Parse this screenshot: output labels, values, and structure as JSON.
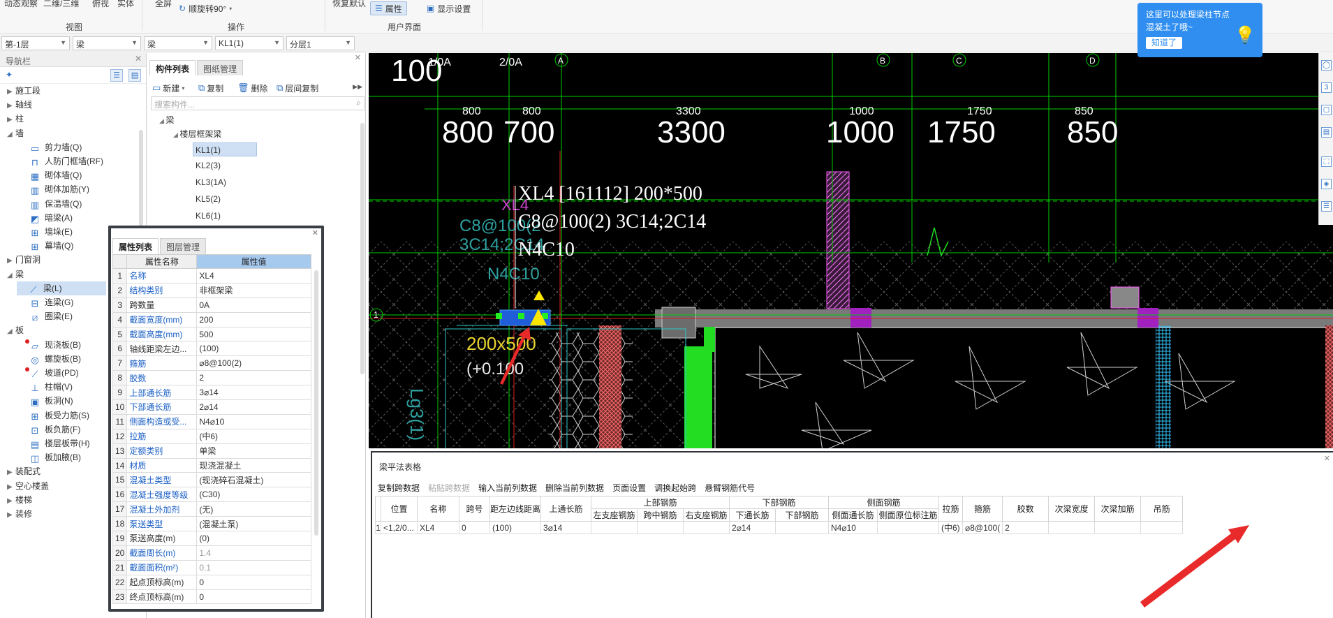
{
  "ribbon": {
    "top_items": [
      "动态观察",
      "二维/三维",
      "俯视",
      "实体",
      "全屏",
      "恢复默认"
    ],
    "groups": [
      "视图",
      "操作",
      "用户界面"
    ],
    "rotate_label": "顺旋转90°",
    "property_label": "属性",
    "display_settings_label": "显示设置"
  },
  "filters": [
    "第-1层",
    "梁",
    "梁",
    "KL1(1)",
    "分层1"
  ],
  "nav": {
    "title": "导航栏",
    "items": [
      {
        "label": "施工段",
        "type": "cat"
      },
      {
        "label": "轴线",
        "type": "cat"
      },
      {
        "label": "柱",
        "type": "cat"
      },
      {
        "label": "墙",
        "type": "cat_open"
      },
      {
        "label": "剪力墙(Q)",
        "type": "sub",
        "icon": "shear-wall-icon"
      },
      {
        "label": "人防门框墙(RF)",
        "type": "sub",
        "icon": "civil-defense-door-wall-icon"
      },
      {
        "label": "砌体墙(Q)",
        "type": "sub",
        "icon": "masonry-wall-icon"
      },
      {
        "label": "砌体加筋(Y)",
        "type": "sub",
        "icon": "masonry-reinforcement-icon"
      },
      {
        "label": "保温墙(Q)",
        "type": "sub",
        "icon": "insulation-wall-icon"
      },
      {
        "label": "暗梁(A)",
        "type": "sub",
        "icon": "hidden-beam-icon"
      },
      {
        "label": "墙垛(E)",
        "type": "sub",
        "icon": "wall-pier-icon"
      },
      {
        "label": "幕墙(Q)",
        "type": "sub",
        "icon": "curtain-wall-icon"
      },
      {
        "label": "门窗洞",
        "type": "cat"
      },
      {
        "label": "梁",
        "type": "cat_open"
      },
      {
        "label": "梁(L)",
        "type": "sub_sel",
        "icon": "beam-icon"
      },
      {
        "label": "连梁(G)",
        "type": "sub",
        "icon": "coupling-beam-icon"
      },
      {
        "label": "圈梁(E)",
        "type": "sub",
        "icon": "ring-beam-icon"
      },
      {
        "label": "板",
        "type": "cat_open"
      },
      {
        "label": "现浇板(B)",
        "type": "sub_dot",
        "icon": "cast-slab-icon"
      },
      {
        "label": "螺旋板(B)",
        "type": "sub",
        "icon": "spiral-slab-icon"
      },
      {
        "label": "坡道(PD)",
        "type": "sub_dot",
        "icon": "ramp-icon"
      },
      {
        "label": "柱帽(V)",
        "type": "sub",
        "icon": "column-cap-icon"
      },
      {
        "label": "板洞(N)",
        "type": "sub",
        "icon": "slab-hole-icon"
      },
      {
        "label": "板受力筋(S)",
        "type": "sub",
        "icon": "slab-rebar-icon"
      },
      {
        "label": "板负筋(F)",
        "type": "sub",
        "icon": "negative-rebar-icon"
      },
      {
        "label": "楼层板带(H)",
        "type": "sub",
        "icon": "floor-strip-icon"
      },
      {
        "label": "板加腋(B)",
        "type": "sub",
        "icon": "slab-haunch-icon"
      },
      {
        "label": "装配式",
        "type": "cat"
      },
      {
        "label": "空心楼盖",
        "type": "cat"
      },
      {
        "label": "楼梯",
        "type": "cat"
      },
      {
        "label": "装修",
        "type": "cat"
      }
    ]
  },
  "components": {
    "tabs": [
      "构件列表",
      "图纸管理"
    ],
    "toolbar": {
      "new": "新建",
      "copy": "复制",
      "delete": "删除",
      "floor_copy": "层间复制"
    },
    "search_placeholder": "搜索构件...",
    "tree_root": "梁",
    "tree_group": "楼层框架梁",
    "items": [
      "KL1(1)",
      "KL2(3)",
      "KL3(1A)",
      "KL5(2)",
      "KL6(1)"
    ]
  },
  "properties": {
    "tabs": [
      "属性列表",
      "图层管理"
    ],
    "header_name": "属性名称",
    "header_value": "属性值",
    "rows": [
      {
        "n": "1",
        "name": "名称",
        "value": "XL4",
        "blue": true,
        "grey": false
      },
      {
        "n": "2",
        "name": "结构类别",
        "value": "非框架梁",
        "blue": true,
        "grey": false
      },
      {
        "n": "3",
        "name": "跨数量",
        "value": "0A",
        "blue": false,
        "grey": false
      },
      {
        "n": "4",
        "name": "截面宽度(mm)",
        "value": "200",
        "blue": true,
        "grey": false
      },
      {
        "n": "5",
        "name": "截面高度(mm)",
        "value": "500",
        "blue": true,
        "grey": false
      },
      {
        "n": "6",
        "name": "轴线距梁左边...",
        "value": "(100)",
        "blue": false,
        "grey": false
      },
      {
        "n": "7",
        "name": "箍筋",
        "value": "⌀8@100(2)",
        "blue": true,
        "grey": false
      },
      {
        "n": "8",
        "name": "胶数",
        "value": "2",
        "blue": true,
        "grey": false
      },
      {
        "n": "9",
        "name": "上部通长筋",
        "value": "3⌀14",
        "blue": true,
        "grey": false
      },
      {
        "n": "10",
        "name": "下部通长筋",
        "value": "2⌀14",
        "blue": true,
        "grey": false
      },
      {
        "n": "11",
        "name": "侧面构造或受...",
        "value": "N4⌀10",
        "blue": true,
        "grey": false
      },
      {
        "n": "12",
        "name": "拉筋",
        "value": "(中6)",
        "blue": true,
        "grey": false
      },
      {
        "n": "13",
        "name": "定额类别",
        "value": "单梁",
        "blue": true,
        "grey": false
      },
      {
        "n": "14",
        "name": "材质",
        "value": "现浇混凝土",
        "blue": true,
        "grey": false
      },
      {
        "n": "15",
        "name": "混凝土类型",
        "value": "(现浇碎石混凝土)",
        "blue": true,
        "grey": false
      },
      {
        "n": "16",
        "name": "混凝土强度等级",
        "value": "(C30)",
        "blue": true,
        "grey": false
      },
      {
        "n": "17",
        "name": "混凝土外加剂",
        "value": "(无)",
        "blue": true,
        "grey": false
      },
      {
        "n": "18",
        "name": "泵送类型",
        "value": "(混凝土泵)",
        "blue": true,
        "grey": false
      },
      {
        "n": "19",
        "name": "泵送高度(m)",
        "value": "(0)",
        "blue": false,
        "grey": false
      },
      {
        "n": "20",
        "name": "截面周长(m)",
        "value": "1.4",
        "blue": true,
        "grey": true
      },
      {
        "n": "21",
        "name": "截面面积(m²)",
        "value": "0.1",
        "blue": true,
        "grey": true
      },
      {
        "n": "22",
        "name": "起点顶标高(m)",
        "value": "0",
        "blue": false,
        "grey": false
      },
      {
        "n": "23",
        "name": "终点顶标高(m)",
        "value": "0",
        "blue": false,
        "grey": false
      }
    ]
  },
  "cad": {
    "axis_labels": [
      "1/0A",
      "2/0A",
      "A",
      "B",
      "C",
      "D",
      "1"
    ],
    "dims_small": [
      "800",
      "800",
      "3300",
      "1000",
      "1750",
      "850"
    ],
    "dims_large": [
      "800",
      "700",
      "3300",
      "1000",
      "1750",
      "850"
    ],
    "dim_left": "100",
    "beam_annotation": [
      "XL4 [161112] 200*500",
      "C8@100(2) 3C14;2C14",
      "N4C10"
    ],
    "section_label": "200x500",
    "elevation_label": "(+0.100",
    "faded_labels": [
      "XL4",
      "C8@100(2",
      "3C14;2C14",
      "N4C10"
    ],
    "side_label": "Lg3(1)"
  },
  "tooltip": {
    "line1": "这里可以处理梁柱节点",
    "line2": "混凝土了哦~",
    "ok": "知道了"
  },
  "beam_table": {
    "title": "梁平法表格",
    "toolbar": [
      "复制跨数据",
      "粘贴跨数据",
      "输入当前列数据",
      "删除当前列数据",
      "页面设置",
      "调换起始跨",
      "悬臂钢筋代号"
    ],
    "group_headers": {
      "top": "上部钢筋",
      "bottom": "下部钢筋",
      "side": "侧面钢筋"
    },
    "columns": [
      "位置",
      "名称",
      "跨号",
      "距左边线距离",
      "上通长筋",
      "左支座钢筋",
      "跨中钢筋",
      "右支座钢筋",
      "下通长筋",
      "下部钢筋",
      "侧面通长筋",
      "侧面原位标注筋",
      "拉筋",
      "箍筋",
      "胶数",
      "次梁宽度",
      "次梁加筋",
      "吊筋"
    ],
    "row": [
      "1",
      "<1,2/0...",
      "XL4",
      "0",
      "(100)",
      "3⌀14",
      "",
      "",
      "",
      "2⌀14",
      "",
      "N4⌀10",
      "",
      "(中6)",
      "⌀8@100(",
      "2",
      "",
      "",
      ""
    ]
  }
}
